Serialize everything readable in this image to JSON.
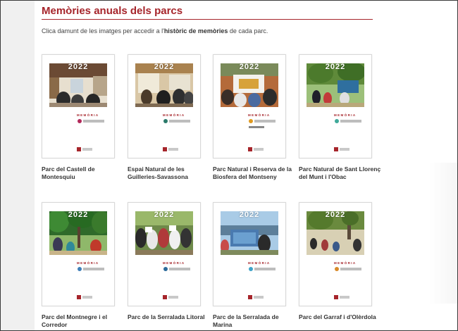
{
  "section": {
    "title": "Memòries anuals dels parcs",
    "intro_before": "Clica damunt de les imatges per accedir a l'",
    "intro_bold": "històric de memòries",
    "intro_after": " de cada parc."
  },
  "colors": {
    "accent": "#a6252b"
  },
  "cover": {
    "year": "2022",
    "memoria_label": "MEMÒRIA"
  },
  "parks": [
    {
      "caption": "Parc del Castell de Montesquiu",
      "logo_color": "#b2295a",
      "photo": "interior"
    },
    {
      "caption": "Espai Natural de les Guilleries-Savassona",
      "logo_color": "#2a7a6a",
      "photo": "interior2"
    },
    {
      "caption": "Parc Natural i Reserva de la Biosfera del Montseny",
      "logo_color": "#e09a20",
      "photo": "crowd"
    },
    {
      "caption": "Parc Natural de Sant Llorenç del Munt i l'Obac",
      "logo_color": "#3fa99a",
      "photo": "forest"
    },
    {
      "caption": "Parc del Montnegre i el Corredor",
      "logo_color": "#3f7fb8",
      "photo": "trees"
    },
    {
      "caption": "Parc de la Serralada Litoral",
      "logo_color": "#2a6a9a",
      "photo": "group"
    },
    {
      "caption": "Parc de la Serralada de Marina",
      "logo_color": "#3ea3c9",
      "photo": "sky"
    },
    {
      "caption": "Parc del Garraf i d'Olèrdola",
      "logo_color": "#d88a2a",
      "photo": "park"
    }
  ]
}
